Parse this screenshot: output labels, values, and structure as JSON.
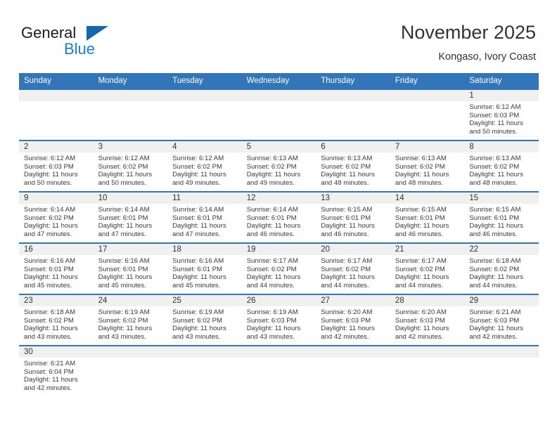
{
  "logo": {
    "word_top": "General",
    "word_bottom": "Blue",
    "triangle_color": "#1667b1",
    "blue_color": "#1b7fd1"
  },
  "header": {
    "title": "November 2025",
    "subtitle": "Kongaso, Ivory Coast"
  },
  "theme": {
    "header_row_bg": "#3275b9",
    "header_row_text": "#ffffff",
    "daynum_bg": "#f0f0f0",
    "cell_bg": "#ffffff",
    "row_border": "#3275b9"
  },
  "weekdays": [
    "Sunday",
    "Monday",
    "Tuesday",
    "Wednesday",
    "Thursday",
    "Friday",
    "Saturday"
  ],
  "weeks": [
    [
      {
        "day": "",
        "lines": []
      },
      {
        "day": "",
        "lines": []
      },
      {
        "day": "",
        "lines": []
      },
      {
        "day": "",
        "lines": []
      },
      {
        "day": "",
        "lines": []
      },
      {
        "day": "",
        "lines": []
      },
      {
        "day": "1",
        "lines": [
          "Sunrise: 6:12 AM",
          "Sunset: 6:03 PM",
          "Daylight: 11 hours",
          "and 50 minutes."
        ]
      }
    ],
    [
      {
        "day": "2",
        "lines": [
          "Sunrise: 6:12 AM",
          "Sunset: 6:03 PM",
          "Daylight: 11 hours",
          "and 50 minutes."
        ]
      },
      {
        "day": "3",
        "lines": [
          "Sunrise: 6:12 AM",
          "Sunset: 6:02 PM",
          "Daylight: 11 hours",
          "and 50 minutes."
        ]
      },
      {
        "day": "4",
        "lines": [
          "Sunrise: 6:12 AM",
          "Sunset: 6:02 PM",
          "Daylight: 11 hours",
          "and 49 minutes."
        ]
      },
      {
        "day": "5",
        "lines": [
          "Sunrise: 6:13 AM",
          "Sunset: 6:02 PM",
          "Daylight: 11 hours",
          "and 49 minutes."
        ]
      },
      {
        "day": "6",
        "lines": [
          "Sunrise: 6:13 AM",
          "Sunset: 6:02 PM",
          "Daylight: 11 hours",
          "and 48 minutes."
        ]
      },
      {
        "day": "7",
        "lines": [
          "Sunrise: 6:13 AM",
          "Sunset: 6:02 PM",
          "Daylight: 11 hours",
          "and 48 minutes."
        ]
      },
      {
        "day": "8",
        "lines": [
          "Sunrise: 6:13 AM",
          "Sunset: 6:02 PM",
          "Daylight: 11 hours",
          "and 48 minutes."
        ]
      }
    ],
    [
      {
        "day": "9",
        "lines": [
          "Sunrise: 6:14 AM",
          "Sunset: 6:02 PM",
          "Daylight: 11 hours",
          "and 47 minutes."
        ]
      },
      {
        "day": "10",
        "lines": [
          "Sunrise: 6:14 AM",
          "Sunset: 6:01 PM",
          "Daylight: 11 hours",
          "and 47 minutes."
        ]
      },
      {
        "day": "11",
        "lines": [
          "Sunrise: 6:14 AM",
          "Sunset: 6:01 PM",
          "Daylight: 11 hours",
          "and 47 minutes."
        ]
      },
      {
        "day": "12",
        "lines": [
          "Sunrise: 6:14 AM",
          "Sunset: 6:01 PM",
          "Daylight: 11 hours",
          "and 46 minutes."
        ]
      },
      {
        "day": "13",
        "lines": [
          "Sunrise: 6:15 AM",
          "Sunset: 6:01 PM",
          "Daylight: 11 hours",
          "and 46 minutes."
        ]
      },
      {
        "day": "14",
        "lines": [
          "Sunrise: 6:15 AM",
          "Sunset: 6:01 PM",
          "Daylight: 11 hours",
          "and 46 minutes."
        ]
      },
      {
        "day": "15",
        "lines": [
          "Sunrise: 6:15 AM",
          "Sunset: 6:01 PM",
          "Daylight: 11 hours",
          "and 46 minutes."
        ]
      }
    ],
    [
      {
        "day": "16",
        "lines": [
          "Sunrise: 6:16 AM",
          "Sunset: 6:01 PM",
          "Daylight: 11 hours",
          "and 45 minutes."
        ]
      },
      {
        "day": "17",
        "lines": [
          "Sunrise: 6:16 AM",
          "Sunset: 6:01 PM",
          "Daylight: 11 hours",
          "and 45 minutes."
        ]
      },
      {
        "day": "18",
        "lines": [
          "Sunrise: 6:16 AM",
          "Sunset: 6:01 PM",
          "Daylight: 11 hours",
          "and 45 minutes."
        ]
      },
      {
        "day": "19",
        "lines": [
          "Sunrise: 6:17 AM",
          "Sunset: 6:02 PM",
          "Daylight: 11 hours",
          "and 44 minutes."
        ]
      },
      {
        "day": "20",
        "lines": [
          "Sunrise: 6:17 AM",
          "Sunset: 6:02 PM",
          "Daylight: 11 hours",
          "and 44 minutes."
        ]
      },
      {
        "day": "21",
        "lines": [
          "Sunrise: 6:17 AM",
          "Sunset: 6:02 PM",
          "Daylight: 11 hours",
          "and 44 minutes."
        ]
      },
      {
        "day": "22",
        "lines": [
          "Sunrise: 6:18 AM",
          "Sunset: 6:02 PM",
          "Daylight: 11 hours",
          "and 44 minutes."
        ]
      }
    ],
    [
      {
        "day": "23",
        "lines": [
          "Sunrise: 6:18 AM",
          "Sunset: 6:02 PM",
          "Daylight: 11 hours",
          "and 43 minutes."
        ]
      },
      {
        "day": "24",
        "lines": [
          "Sunrise: 6:19 AM",
          "Sunset: 6:02 PM",
          "Daylight: 11 hours",
          "and 43 minutes."
        ]
      },
      {
        "day": "25",
        "lines": [
          "Sunrise: 6:19 AM",
          "Sunset: 6:02 PM",
          "Daylight: 11 hours",
          "and 43 minutes."
        ]
      },
      {
        "day": "26",
        "lines": [
          "Sunrise: 6:19 AM",
          "Sunset: 6:03 PM",
          "Daylight: 11 hours",
          "and 43 minutes."
        ]
      },
      {
        "day": "27",
        "lines": [
          "Sunrise: 6:20 AM",
          "Sunset: 6:03 PM",
          "Daylight: 11 hours",
          "and 42 minutes."
        ]
      },
      {
        "day": "28",
        "lines": [
          "Sunrise: 6:20 AM",
          "Sunset: 6:03 PM",
          "Daylight: 11 hours",
          "and 42 minutes."
        ]
      },
      {
        "day": "29",
        "lines": [
          "Sunrise: 6:21 AM",
          "Sunset: 6:03 PM",
          "Daylight: 11 hours",
          "and 42 minutes."
        ]
      }
    ],
    [
      {
        "day": "30",
        "lines": [
          "Sunrise: 6:21 AM",
          "Sunset: 6:04 PM",
          "Daylight: 11 hours",
          "and 42 minutes."
        ]
      },
      {
        "day": "",
        "lines": []
      },
      {
        "day": "",
        "lines": []
      },
      {
        "day": "",
        "lines": []
      },
      {
        "day": "",
        "lines": []
      },
      {
        "day": "",
        "lines": []
      },
      {
        "day": "",
        "lines": []
      }
    ]
  ]
}
